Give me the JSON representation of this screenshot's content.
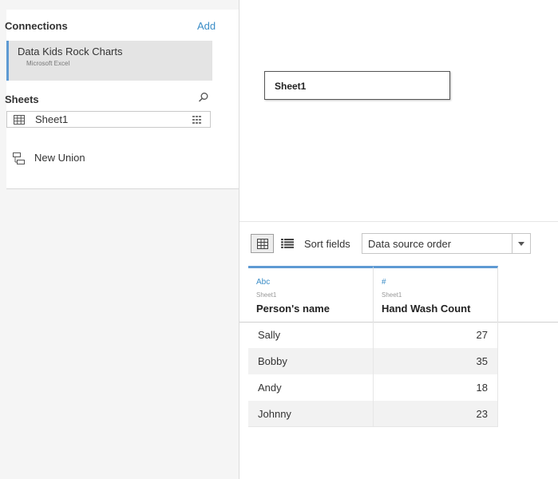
{
  "connections": {
    "title": "Connections",
    "add_label": "Add",
    "item": {
      "name": "Data Kids Rock Charts",
      "type": "Microsoft Excel"
    }
  },
  "sheets": {
    "title": "Sheets",
    "items": [
      {
        "label": "Sheet1"
      }
    ],
    "new_union_label": "New Union"
  },
  "canvas": {
    "table_label": "Sheet1"
  },
  "toolbar": {
    "sort_label": "Sort fields",
    "sort_value": "Data source order"
  },
  "grid": {
    "columns": [
      {
        "type_badge": "Abc",
        "source": "Sheet1",
        "name": "Person's name"
      },
      {
        "type_badge": "#",
        "source": "Sheet1",
        "name": "Hand Wash Count"
      }
    ],
    "rows": [
      [
        "Sally",
        "27"
      ],
      [
        "Bobby",
        "35"
      ],
      [
        "Andy",
        "18"
      ],
      [
        "Johnny",
        "23"
      ]
    ]
  },
  "colors": {
    "accent": "#5e9ad3",
    "link": "#3b8dc7"
  }
}
